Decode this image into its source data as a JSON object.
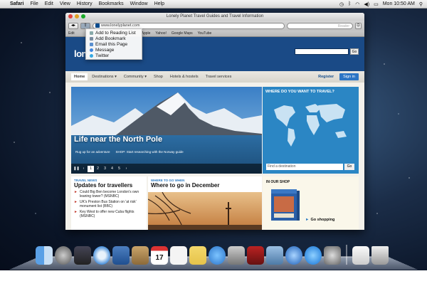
{
  "menubar": {
    "app_name": "Safari",
    "items": [
      "File",
      "Edit",
      "View",
      "History",
      "Bookmarks",
      "Window",
      "Help"
    ],
    "clock": "Mon 10:50 AM"
  },
  "window": {
    "title": "Lonely Planet Travel Guides and Travel Information",
    "url": "www.lonelyplanet.com",
    "search_placeholder": "Reader",
    "bookmarks": [
      "Apple",
      "Yahoo!",
      "Google Maps",
      "YouTube"
    ],
    "bookmarks_prefix": "Edit"
  },
  "share_menu": [
    {
      "label": "Add to Reading List",
      "icon": "reading-list-icon"
    },
    {
      "label": "Add Bookmark",
      "icon": "bookmark-icon"
    },
    {
      "label": "Email this Page",
      "icon": "email-icon"
    },
    {
      "label": "Message",
      "icon": "message-icon"
    },
    {
      "label": "Twitter",
      "icon": "twitter-icon"
    }
  ],
  "site": {
    "logo": "lonel",
    "search_go": "Go",
    "nav": [
      "Home",
      "Destinations",
      "Community",
      "Shop",
      "Hotels & hostels",
      "Travel services"
    ],
    "register": "Register",
    "signin": "Sign in",
    "hero": {
      "caption": "Life near the North Pole",
      "sub_links": [
        "Rug up for an adventure",
        "SHOP: Start researching with the Norway guide"
      ],
      "pages": [
        "1",
        "2",
        "3",
        "4",
        "5"
      ]
    },
    "where": {
      "title": "WHERE DO YOU WANT TO TRAVEL?",
      "placeholder": "Find a destination",
      "go": "Go"
    },
    "news": {
      "label": "TRAVEL NEWS",
      "title": "Updates for travellers",
      "items": [
        "Could Big Ben become London's own leaning tower? (MSNBC)",
        "UK's Preston Bus Station on 'at risk' monument list (BBC)",
        "Key West to offer new Cuba flights (MSNBC)"
      ]
    },
    "where_to_go": {
      "label": "WHERE TO GO WHEN",
      "title": "Where to go in December"
    },
    "shop": {
      "title": "IN OUR SHOP",
      "link": "Go shopping"
    }
  },
  "dock": [
    "finder-icon",
    "launchpad-icon",
    "mission-control-icon",
    "safari-icon",
    "mail-icon",
    "contacts-icon",
    "calendar-icon",
    "reminders-icon",
    "notes-icon",
    "messages-icon",
    "facetime-icon",
    "photo-booth-icon",
    "iphoto-icon",
    "itunes-icon",
    "app-store-icon",
    "system-preferences-icon",
    "documents-icon",
    "trash-icon"
  ]
}
